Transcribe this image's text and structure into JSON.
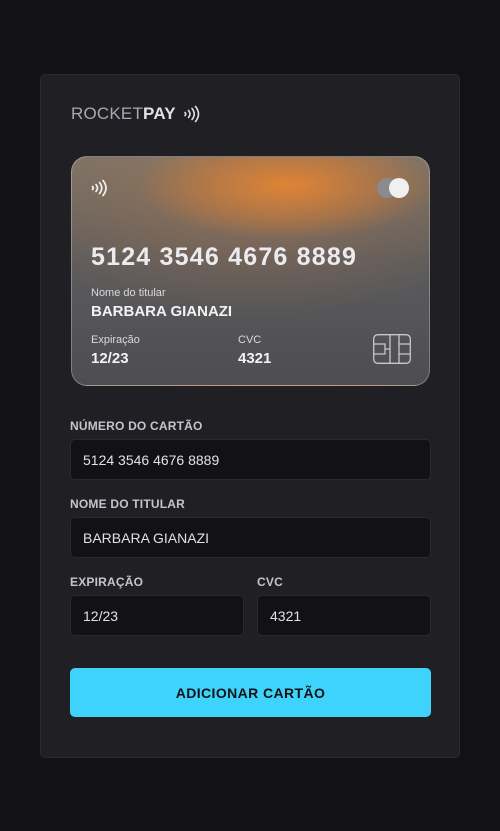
{
  "logo": {
    "part1": "ROCKET",
    "part2": "PAY",
    "icon": "contactless-icon"
  },
  "card": {
    "number": "5124 3546 4676 8889",
    "holder_label": "Nome do titular",
    "holder": "BARBARA GIANAZI",
    "expiry_label": "Expiração",
    "expiry": "12/23",
    "cvc_label": "CVC",
    "cvc": "4321",
    "brand_icon": "mastercard-icon",
    "chip_icon": "card-chip-icon"
  },
  "form": {
    "number_label": "NÚMERO DO CARTÃO",
    "number_value": "5124 3546 4676 8889",
    "holder_label": "NOME DO TITULAR",
    "holder_value": "BARBARA GIANAZI",
    "expiry_label": "EXPIRAÇÃO",
    "expiry_value": "12/23",
    "cvc_label": "CVC",
    "cvc_value": "4321",
    "submit_label": "ADICIONAR CARTÃO"
  },
  "colors": {
    "background": "#121214",
    "panel": "#202024",
    "accent": "#3ed3fb",
    "card_glow": "#e0843a"
  }
}
